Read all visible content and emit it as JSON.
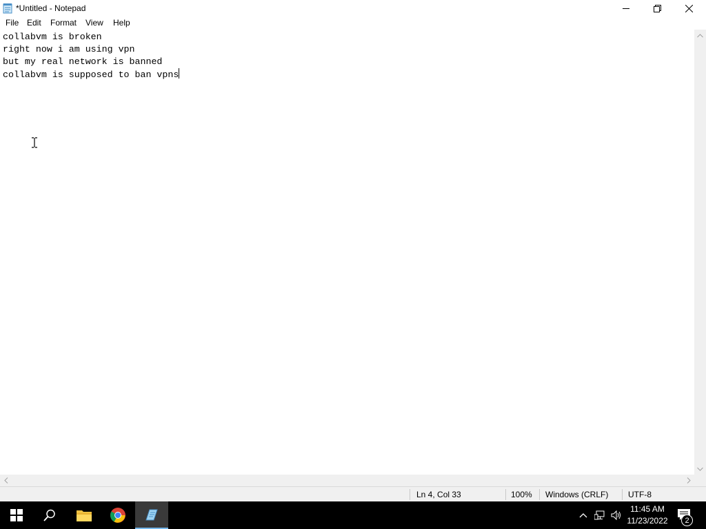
{
  "window": {
    "title": "*Untitled - Notepad",
    "minimize_label": "",
    "maximize_label": "",
    "close_label": ""
  },
  "menu": [
    "File",
    "Edit",
    "Format",
    "View",
    "Help"
  ],
  "editor": {
    "lines": [
      "collabvm is broken",
      "right now i am using vpn",
      "but my real network is banned",
      "collabvm is supposed to ban vpns"
    ]
  },
  "status": {
    "position": "Ln 4, Col 33",
    "zoom": "100%",
    "line_ending": "Windows (CRLF)",
    "encoding": "UTF-8"
  },
  "taskbar": {
    "apps": [
      "start-icon",
      "search-icon",
      "file-explorer-icon",
      "chrome-icon",
      "notepad-icon"
    ],
    "active_app": "notepad-icon",
    "clock_time": "11:45 AM",
    "clock_date": "11/23/2022",
    "notification_count": "2"
  },
  "colors": {
    "taskbar_bg": "#000000",
    "accent": "#76b9ed",
    "statusbar_bg": "#f0f0f0"
  }
}
